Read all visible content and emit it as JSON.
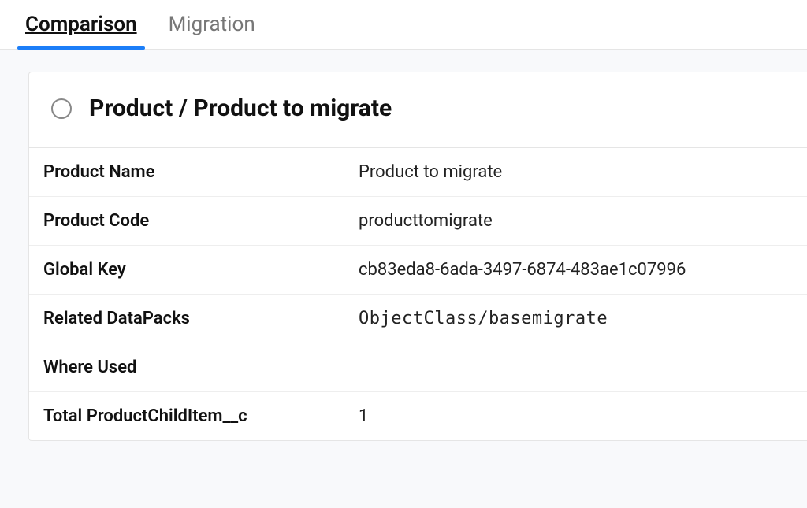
{
  "tabs": [
    {
      "label": "Comparison",
      "active": true
    },
    {
      "label": "Migration",
      "active": false
    }
  ],
  "card": {
    "title": "Product / Product to migrate",
    "fields": [
      {
        "label": "Product Name",
        "value": "Product to migrate",
        "mono": false
      },
      {
        "label": "Product Code",
        "value": "producttomigrate",
        "mono": false
      },
      {
        "label": "Global Key",
        "value": "cb83eda8-6ada-3497-6874-483ae1c07996",
        "mono": false
      },
      {
        "label": "Related DataPacks",
        "value": "ObjectClass/basemigrate",
        "mono": true
      },
      {
        "label": "Where Used",
        "value": "",
        "mono": false
      },
      {
        "label": "Total ProductChildItem__c",
        "value": "1",
        "mono": false
      }
    ]
  }
}
